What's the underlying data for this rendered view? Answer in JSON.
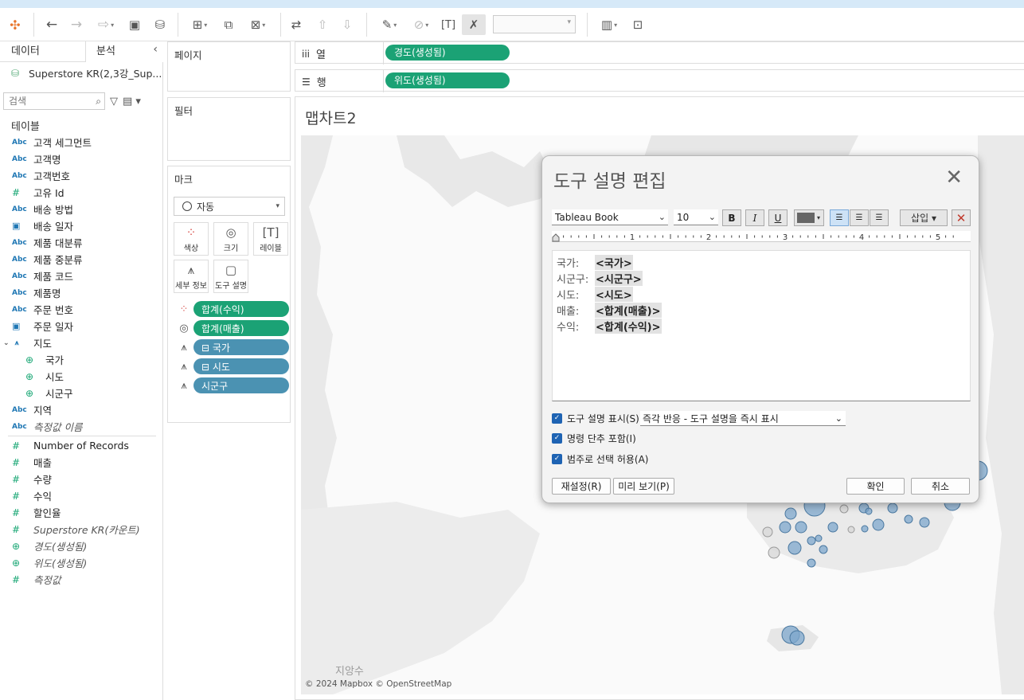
{
  "toolbar": {
    "icons": [
      "tableau-logo-icon",
      "undo-icon",
      "redo-icon",
      "replay-icon",
      "save-icon",
      "new-datasource-icon",
      "new-worksheet-icon",
      "duplicate-icon",
      "clear-sheet-icon",
      "swap-icon",
      "sort-ascending-icon",
      "sort-descending-icon",
      "highlight-icon",
      "attach-icon",
      "label-text-icon",
      "pin-tooltip-icon",
      "show-me-icon",
      "presentation-icon"
    ],
    "fit_select_value": ""
  },
  "datapane": {
    "tabs": [
      "데이터",
      "분석"
    ],
    "source": "Superstore KR(2,3강_Sup...",
    "search_placeholder": "검색",
    "tables_heading": "테이블",
    "fields": [
      {
        "type": "Abc",
        "label": "고객 세그먼트"
      },
      {
        "type": "Abc",
        "label": "고객명"
      },
      {
        "type": "Abc",
        "label": "고객번호"
      },
      {
        "type": "#",
        "label": "고유 Id"
      },
      {
        "type": "Abc",
        "label": "배송 방법"
      },
      {
        "type": "date",
        "label": "배송 일자"
      },
      {
        "type": "Abc",
        "label": "제품 대분류"
      },
      {
        "type": "Abc",
        "label": "제품 중분류"
      },
      {
        "type": "Abc",
        "label": "제품 코드"
      },
      {
        "type": "Abc",
        "label": "제품명"
      },
      {
        "type": "Abc",
        "label": "주문 번호"
      },
      {
        "type": "date",
        "label": "주문 일자"
      },
      {
        "type": "hier",
        "label": "지도"
      },
      {
        "type": "geo",
        "label": "국가",
        "sub": true
      },
      {
        "type": "geo",
        "label": "시도",
        "sub": true
      },
      {
        "type": "geo",
        "label": "시군구",
        "sub": true
      },
      {
        "type": "Abc",
        "label": "지역"
      },
      {
        "type": "Abc",
        "label": "측정값 이름",
        "italic": true
      }
    ],
    "measures": [
      {
        "type": "#",
        "label": "Number of Records"
      },
      {
        "type": "#",
        "label": "매출"
      },
      {
        "type": "#",
        "label": "수량"
      },
      {
        "type": "#",
        "label": "수익"
      },
      {
        "type": "#",
        "label": "할인율"
      },
      {
        "type": "#",
        "label": "Superstore KR(카운트)",
        "italic": true
      },
      {
        "type": "geo",
        "label": "경도(생성됨)",
        "italic": true
      },
      {
        "type": "geo",
        "label": "위도(생성됨)",
        "italic": true
      },
      {
        "type": "#",
        "label": "측정값",
        "italic": true
      }
    ]
  },
  "cards": {
    "pages": "페이지",
    "filters": "필터",
    "marks": "마크",
    "mark_type": "자동",
    "mark_buttons": [
      {
        "label": "색상",
        "icon": "color-icon"
      },
      {
        "label": "크기",
        "icon": "size-icon"
      },
      {
        "label": "레이블",
        "icon": "label-icon"
      },
      {
        "label": "세부 정보",
        "icon": "detail-icon"
      },
      {
        "label": "도구 설명",
        "icon": "tooltip-icon"
      }
    ],
    "mark_pills": [
      {
        "label": "합계(수익)",
        "color": "green",
        "icon": "color-icon"
      },
      {
        "label": "합계(매출)",
        "color": "green",
        "icon": "size-icon"
      },
      {
        "label": "⊟ 국가",
        "color": "blue",
        "icon": "detail-icon"
      },
      {
        "label": "⊟ 시도",
        "color": "blue",
        "icon": "detail-icon"
      },
      {
        "label": "시군구",
        "color": "blue",
        "icon": "detail-icon"
      }
    ]
  },
  "shelves": {
    "columns_label": "열",
    "columns_pill": "경도(생성됨)",
    "rows_label": "행",
    "rows_pill": "위도(생성됨)"
  },
  "view": {
    "title": "맵차트2",
    "attribution": "© 2024 Mapbox © OpenStreetMap",
    "map_labels": [
      "지앙수"
    ]
  },
  "dialog": {
    "title": "도구 설명 편집",
    "font": "Tableau Book",
    "size": "10",
    "bold": "B",
    "italic": "I",
    "underline": "U",
    "insert": "삽입",
    "ruler_marks": [
      "1",
      "2",
      "3",
      "4",
      "5"
    ],
    "lines": [
      {
        "key": "국가:",
        "value": "<국가>"
      },
      {
        "key": "시군구:",
        "value": "<시군구>"
      },
      {
        "key": "시도:",
        "value": "<시도>"
      },
      {
        "key": "매출:",
        "value": "<합계(매출)>"
      },
      {
        "key": "수익:",
        "value": "<합계(수익)>"
      }
    ],
    "opt_show": "도구 설명 표시(S)",
    "opt_show_select": "즉각 반응 - 도구 설명을 즉시 표시",
    "opt_commands": "명령 단추 포함(I)",
    "opt_range": "범주로 선택 허용(A)",
    "reset": "재설정(R)",
    "preview": "미리 보기(P)",
    "ok": "확인",
    "cancel": "취소"
  },
  "colors": {
    "green_pill": "#1ba275",
    "blue_pill": "#4b92b2",
    "checkbox": "#1e63b3",
    "map_circle": "#6d9ac4"
  }
}
